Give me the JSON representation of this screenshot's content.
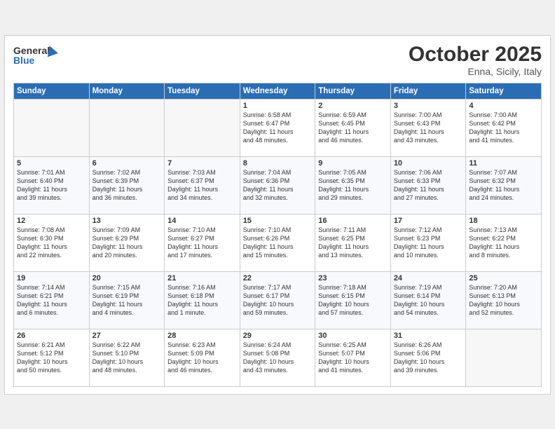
{
  "header": {
    "logo_line1": "General",
    "logo_line2": "Blue",
    "month": "October 2025",
    "location": "Enna, Sicily, Italy"
  },
  "days_of_week": [
    "Sunday",
    "Monday",
    "Tuesday",
    "Wednesday",
    "Thursday",
    "Friday",
    "Saturday"
  ],
  "weeks": [
    [
      {
        "day": "",
        "info": ""
      },
      {
        "day": "",
        "info": ""
      },
      {
        "day": "",
        "info": ""
      },
      {
        "day": "1",
        "info": "Sunrise: 6:58 AM\nSunset: 6:47 PM\nDaylight: 11 hours\nand 48 minutes."
      },
      {
        "day": "2",
        "info": "Sunrise: 6:59 AM\nSunset: 6:45 PM\nDaylight: 11 hours\nand 46 minutes."
      },
      {
        "day": "3",
        "info": "Sunrise: 7:00 AM\nSunset: 6:43 PM\nDaylight: 11 hours\nand 43 minutes."
      },
      {
        "day": "4",
        "info": "Sunrise: 7:00 AM\nSunset: 6:42 PM\nDaylight: 11 hours\nand 41 minutes."
      }
    ],
    [
      {
        "day": "5",
        "info": "Sunrise: 7:01 AM\nSunset: 6:40 PM\nDaylight: 11 hours\nand 39 minutes."
      },
      {
        "day": "6",
        "info": "Sunrise: 7:02 AM\nSunset: 6:39 PM\nDaylight: 11 hours\nand 36 minutes."
      },
      {
        "day": "7",
        "info": "Sunrise: 7:03 AM\nSunset: 6:37 PM\nDaylight: 11 hours\nand 34 minutes."
      },
      {
        "day": "8",
        "info": "Sunrise: 7:04 AM\nSunset: 6:36 PM\nDaylight: 11 hours\nand 32 minutes."
      },
      {
        "day": "9",
        "info": "Sunrise: 7:05 AM\nSunset: 6:35 PM\nDaylight: 11 hours\nand 29 minutes."
      },
      {
        "day": "10",
        "info": "Sunrise: 7:06 AM\nSunset: 6:33 PM\nDaylight: 11 hours\nand 27 minutes."
      },
      {
        "day": "11",
        "info": "Sunrise: 7:07 AM\nSunset: 6:32 PM\nDaylight: 11 hours\nand 24 minutes."
      }
    ],
    [
      {
        "day": "12",
        "info": "Sunrise: 7:08 AM\nSunset: 6:30 PM\nDaylight: 11 hours\nand 22 minutes."
      },
      {
        "day": "13",
        "info": "Sunrise: 7:09 AM\nSunset: 6:29 PM\nDaylight: 11 hours\nand 20 minutes."
      },
      {
        "day": "14",
        "info": "Sunrise: 7:10 AM\nSunset: 6:27 PM\nDaylight: 11 hours\nand 17 minutes."
      },
      {
        "day": "15",
        "info": "Sunrise: 7:10 AM\nSunset: 6:26 PM\nDaylight: 11 hours\nand 15 minutes."
      },
      {
        "day": "16",
        "info": "Sunrise: 7:11 AM\nSunset: 6:25 PM\nDaylight: 11 hours\nand 13 minutes."
      },
      {
        "day": "17",
        "info": "Sunrise: 7:12 AM\nSunset: 6:23 PM\nDaylight: 11 hours\nand 10 minutes."
      },
      {
        "day": "18",
        "info": "Sunrise: 7:13 AM\nSunset: 6:22 PM\nDaylight: 11 hours\nand 8 minutes."
      }
    ],
    [
      {
        "day": "19",
        "info": "Sunrise: 7:14 AM\nSunset: 6:21 PM\nDaylight: 11 hours\nand 6 minutes."
      },
      {
        "day": "20",
        "info": "Sunrise: 7:15 AM\nSunset: 6:19 PM\nDaylight: 11 hours\nand 4 minutes."
      },
      {
        "day": "21",
        "info": "Sunrise: 7:16 AM\nSunset: 6:18 PM\nDaylight: 11 hours\nand 1 minute."
      },
      {
        "day": "22",
        "info": "Sunrise: 7:17 AM\nSunset: 6:17 PM\nDaylight: 10 hours\nand 59 minutes."
      },
      {
        "day": "23",
        "info": "Sunrise: 7:18 AM\nSunset: 6:15 PM\nDaylight: 10 hours\nand 57 minutes."
      },
      {
        "day": "24",
        "info": "Sunrise: 7:19 AM\nSunset: 6:14 PM\nDaylight: 10 hours\nand 54 minutes."
      },
      {
        "day": "25",
        "info": "Sunrise: 7:20 AM\nSunset: 6:13 PM\nDaylight: 10 hours\nand 52 minutes."
      }
    ],
    [
      {
        "day": "26",
        "info": "Sunrise: 6:21 AM\nSunset: 5:12 PM\nDaylight: 10 hours\nand 50 minutes."
      },
      {
        "day": "27",
        "info": "Sunrise: 6:22 AM\nSunset: 5:10 PM\nDaylight: 10 hours\nand 48 minutes."
      },
      {
        "day": "28",
        "info": "Sunrise: 6:23 AM\nSunset: 5:09 PM\nDaylight: 10 hours\nand 46 minutes."
      },
      {
        "day": "29",
        "info": "Sunrise: 6:24 AM\nSunset: 5:08 PM\nDaylight: 10 hours\nand 43 minutes."
      },
      {
        "day": "30",
        "info": "Sunrise: 6:25 AM\nSunset: 5:07 PM\nDaylight: 10 hours\nand 41 minutes."
      },
      {
        "day": "31",
        "info": "Sunrise: 6:26 AM\nSunset: 5:06 PM\nDaylight: 10 hours\nand 39 minutes."
      },
      {
        "day": "",
        "info": ""
      }
    ]
  ]
}
